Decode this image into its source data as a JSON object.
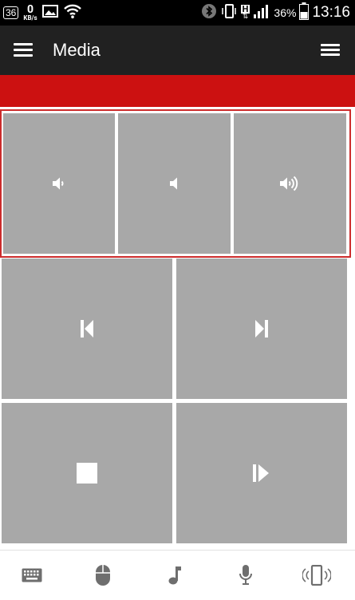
{
  "status_bar": {
    "notification_count": "36",
    "data_rate_value": "0",
    "data_rate_unit": "KB/s",
    "network_type": "H",
    "battery_percent": "36%",
    "time": "13:16",
    "icons": [
      "notification-badge-icon",
      "gallery-icon",
      "wifi-icon",
      "bluetooth-icon",
      "vibrate-icon",
      "h-network-icon",
      "signal-icon",
      "battery-icon"
    ]
  },
  "app_bar": {
    "title": "Media",
    "left_icon": "hamburger-menu-icon",
    "right_icon": "options-menu-icon"
  },
  "colors": {
    "status_bar": "#000000",
    "app_bar": "#212121",
    "accent_red": "#cc1111",
    "group_border": "#cc2c2c",
    "tile": "#a8a8a8",
    "nav_icon": "#6e6e6e"
  },
  "volume_controls": [
    "volume-down-icon",
    "mute-icon",
    "volume-up-icon"
  ],
  "media_controls": [
    "previous-track-icon",
    "next-track-icon",
    "stop-icon",
    "play-pause-icon"
  ],
  "bottom_nav": [
    "keyboard-icon",
    "mouse-icon",
    "music-note-icon",
    "microphone-icon",
    "vibrate-phone-icon"
  ]
}
